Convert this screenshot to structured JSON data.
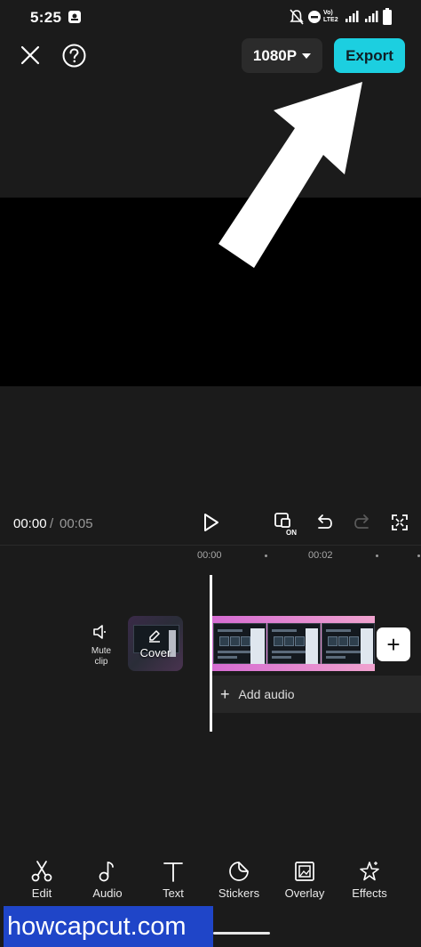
{
  "status_bar": {
    "time": "5:25",
    "network_label": "Vo) LTE2"
  },
  "top_bar": {
    "resolution": "1080P",
    "export_label": "Export",
    "accent": "#1ccfe0"
  },
  "playback": {
    "current": "00:00",
    "separator": "/",
    "total": "00:05"
  },
  "ruler": {
    "labels": [
      "00:00",
      "00:02"
    ]
  },
  "timeline": {
    "mute_label": "Mute clip",
    "cover_label": "Cover",
    "add_audio_label": "Add audio",
    "add_clip_symbol": "+"
  },
  "toolbar": {
    "items": [
      {
        "label": "Edit",
        "icon": "scissors-icon"
      },
      {
        "label": "Audio",
        "icon": "music-note-icon"
      },
      {
        "label": "Text",
        "icon": "text-icon"
      },
      {
        "label": "Stickers",
        "icon": "sticker-icon"
      },
      {
        "label": "Overlay",
        "icon": "overlay-icon"
      },
      {
        "label": "Effects",
        "icon": "sparkle-star-icon"
      }
    ]
  },
  "watermark": "howcapcut.com"
}
